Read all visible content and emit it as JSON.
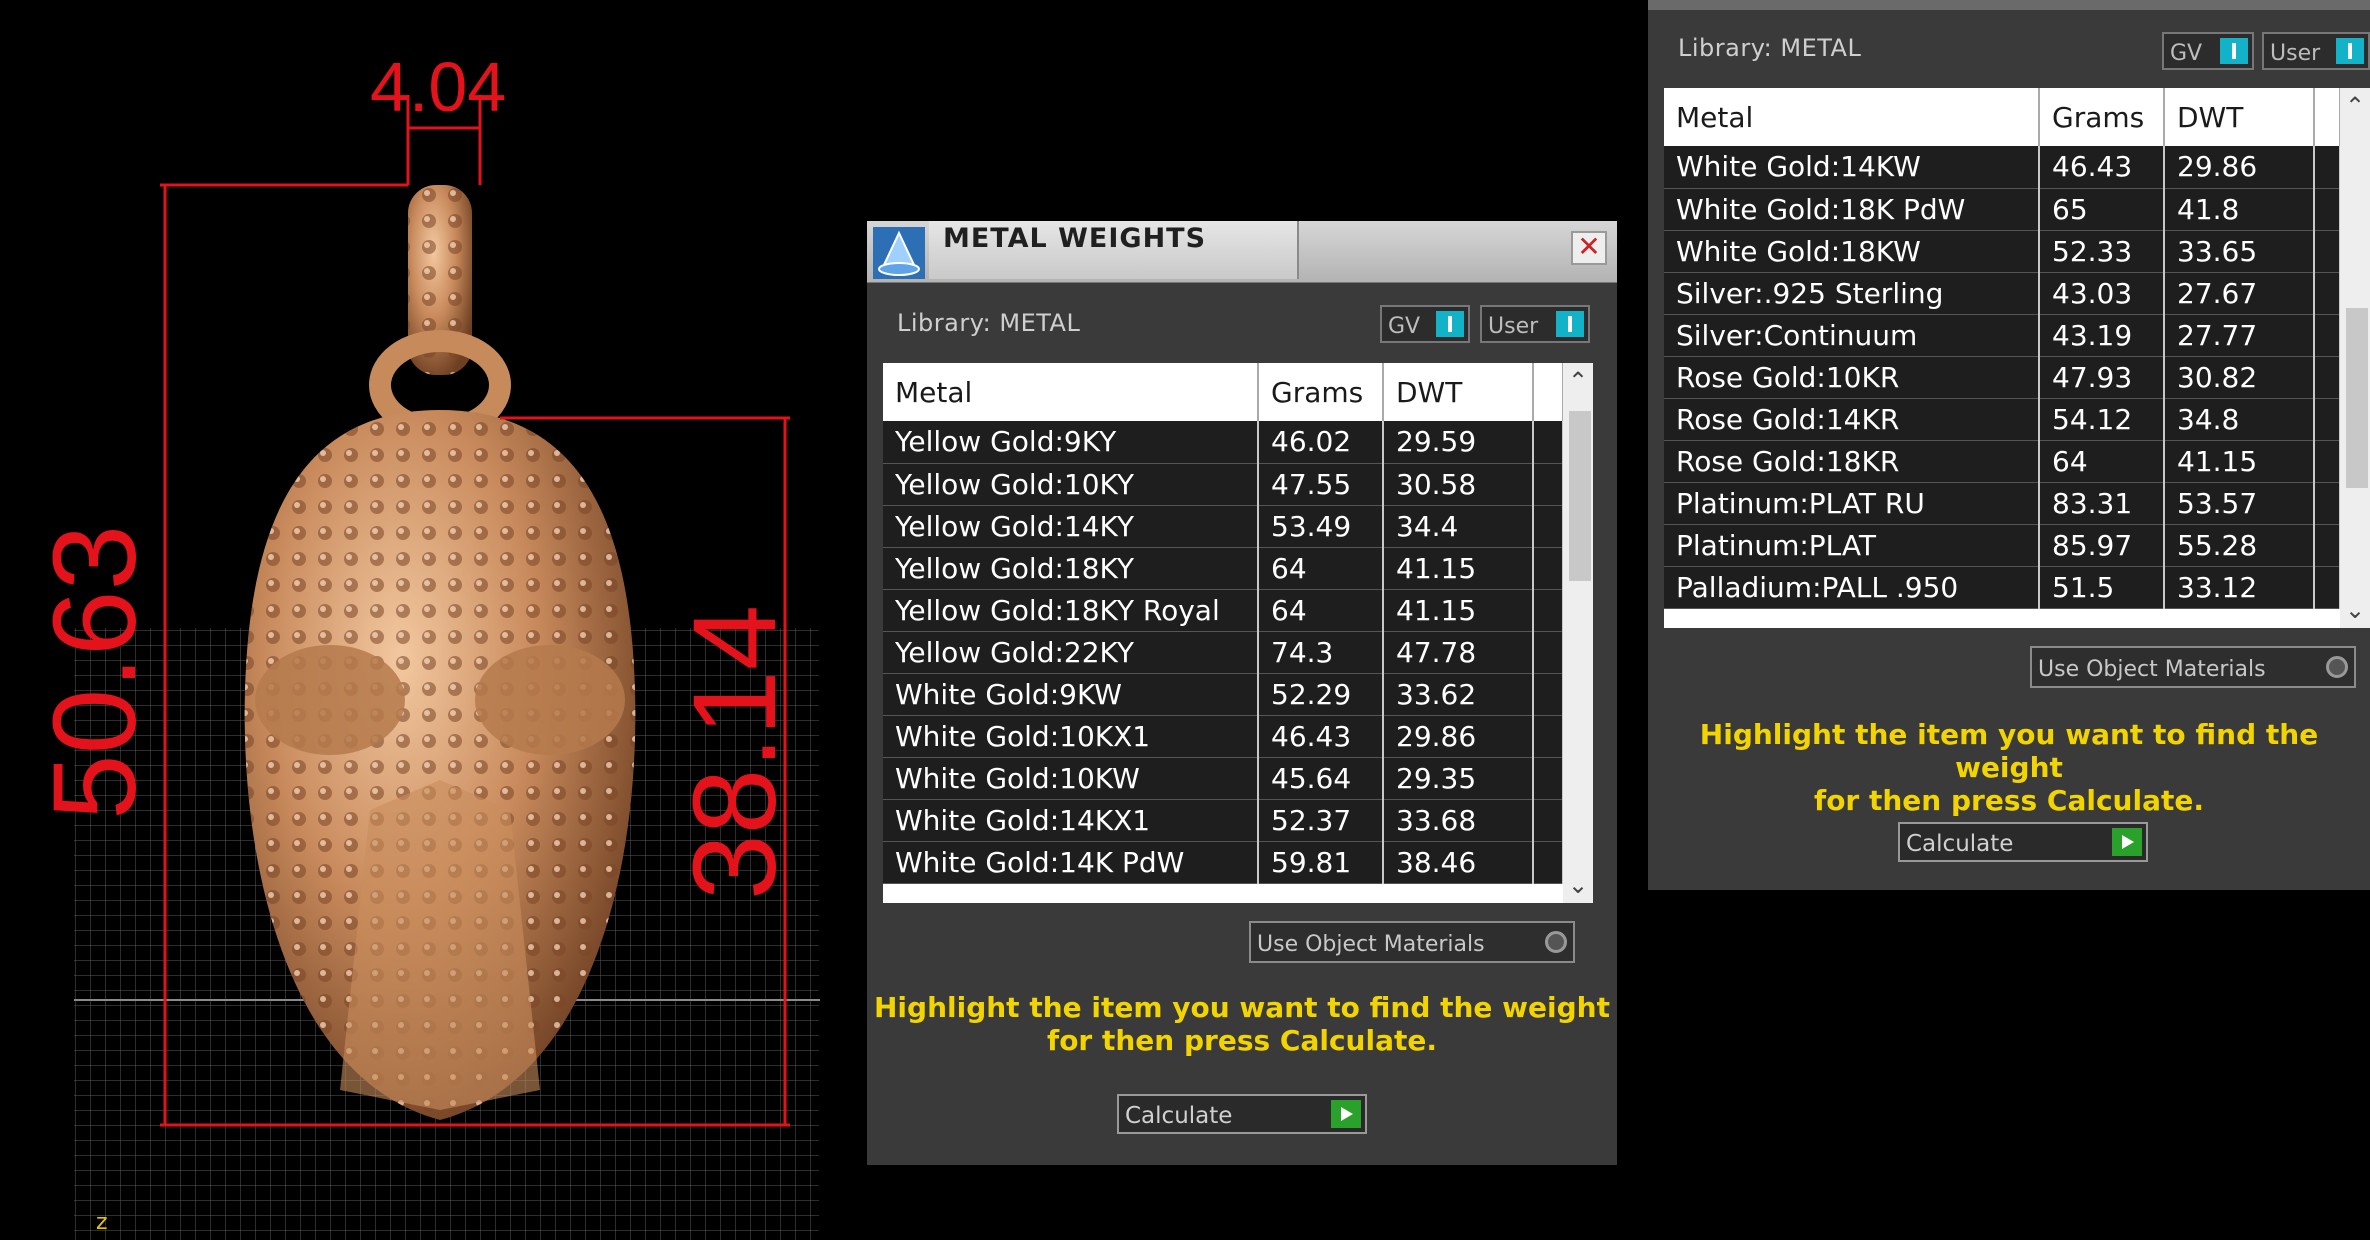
{
  "viewport": {
    "dim_top": "4.04",
    "dim_left": "50.63",
    "dim_right": "38.14",
    "axis_label": "z"
  },
  "metal_window": {
    "title": "METAL WEIGHTS",
    "close_glyph": "✕",
    "library_label": "Library: METAL",
    "toggle_gv": "GV",
    "toggle_user": "User",
    "columns": [
      "Metal",
      "Grams",
      "DWT"
    ],
    "rows": [
      [
        "Yellow Gold:9KY",
        "46.02",
        "29.59"
      ],
      [
        "Yellow Gold:10KY",
        "47.55",
        "30.58"
      ],
      [
        "Yellow Gold:14KY",
        "53.49",
        "34.4"
      ],
      [
        "Yellow Gold:18KY",
        "64",
        "41.15"
      ],
      [
        "Yellow Gold:18KY Royal",
        "64",
        "41.15"
      ],
      [
        "Yellow Gold:22KY",
        "74.3",
        "47.78"
      ],
      [
        "White Gold:9KW",
        "52.29",
        "33.62"
      ],
      [
        "White Gold:10KX1",
        "46.43",
        "29.86"
      ],
      [
        "White Gold:10KW",
        "45.64",
        "29.35"
      ],
      [
        "White Gold:14KX1",
        "52.37",
        "33.68"
      ],
      [
        "White Gold:14K PdW",
        "59.81",
        "38.46"
      ]
    ],
    "use_object_materials": "Use Object Materials",
    "hint_line1": "Highlight the item you want to find the weight",
    "hint_line2": "for then press Calculate.",
    "calculate": "Calculate"
  },
  "metal_window_scrolled": {
    "library_label": "Library: METAL",
    "toggle_gv": "GV",
    "toggle_user": "User",
    "columns": [
      "Metal",
      "Grams",
      "DWT"
    ],
    "rows": [
      [
        "White Gold:14KW",
        "46.43",
        "29.86"
      ],
      [
        "White Gold:18K PdW",
        "65",
        "41.8"
      ],
      [
        "White Gold:18KW",
        "52.33",
        "33.65"
      ],
      [
        "Silver:.925 Sterling",
        "43.03",
        "27.67"
      ],
      [
        "Silver:Continuum",
        "43.19",
        "27.77"
      ],
      [
        "Rose Gold:10KR",
        "47.93",
        "30.82"
      ],
      [
        "Rose Gold:14KR",
        "54.12",
        "34.8"
      ],
      [
        "Rose Gold:18KR",
        "64",
        "41.15"
      ],
      [
        "Platinum:PLAT RU",
        "83.31",
        "53.57"
      ],
      [
        "Platinum:PLAT",
        "85.97",
        "55.28"
      ],
      [
        "Palladium:PALL .950",
        "51.5",
        "33.12"
      ]
    ],
    "use_object_materials": "Use Object Materials",
    "hint_line1": "Highlight the item you want to find the weight",
    "hint_line2": "for then press Calculate.",
    "calculate": "Calculate"
  }
}
